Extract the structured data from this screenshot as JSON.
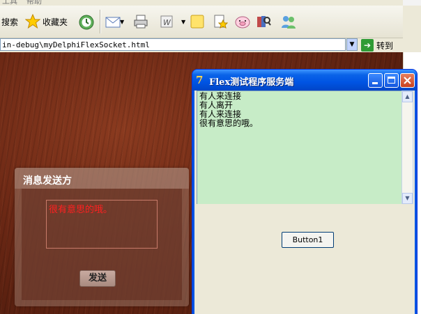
{
  "menu": {
    "item1": "工具",
    "item2": "帮助"
  },
  "toolbar": {
    "search_label": "搜索",
    "favorites_label": "收藏夹"
  },
  "address": {
    "url": "in-debug\\myDelphiFlexSocket.html",
    "go_label": "转到"
  },
  "flex_panel": {
    "title": "消息发送方",
    "message_text": "很有意思的哦。",
    "send_label": "发送"
  },
  "server_window": {
    "title": "Flex测试程序服务端",
    "log_lines": [
      "有人来连接",
      "有人离开",
      "有人来连接",
      "很有意思的哦。"
    ],
    "button_label": "Button1"
  },
  "colors": {
    "titlebar_blue": "#0054e3",
    "memo_green": "#c7ecc7",
    "message_red": "#ff2020"
  }
}
